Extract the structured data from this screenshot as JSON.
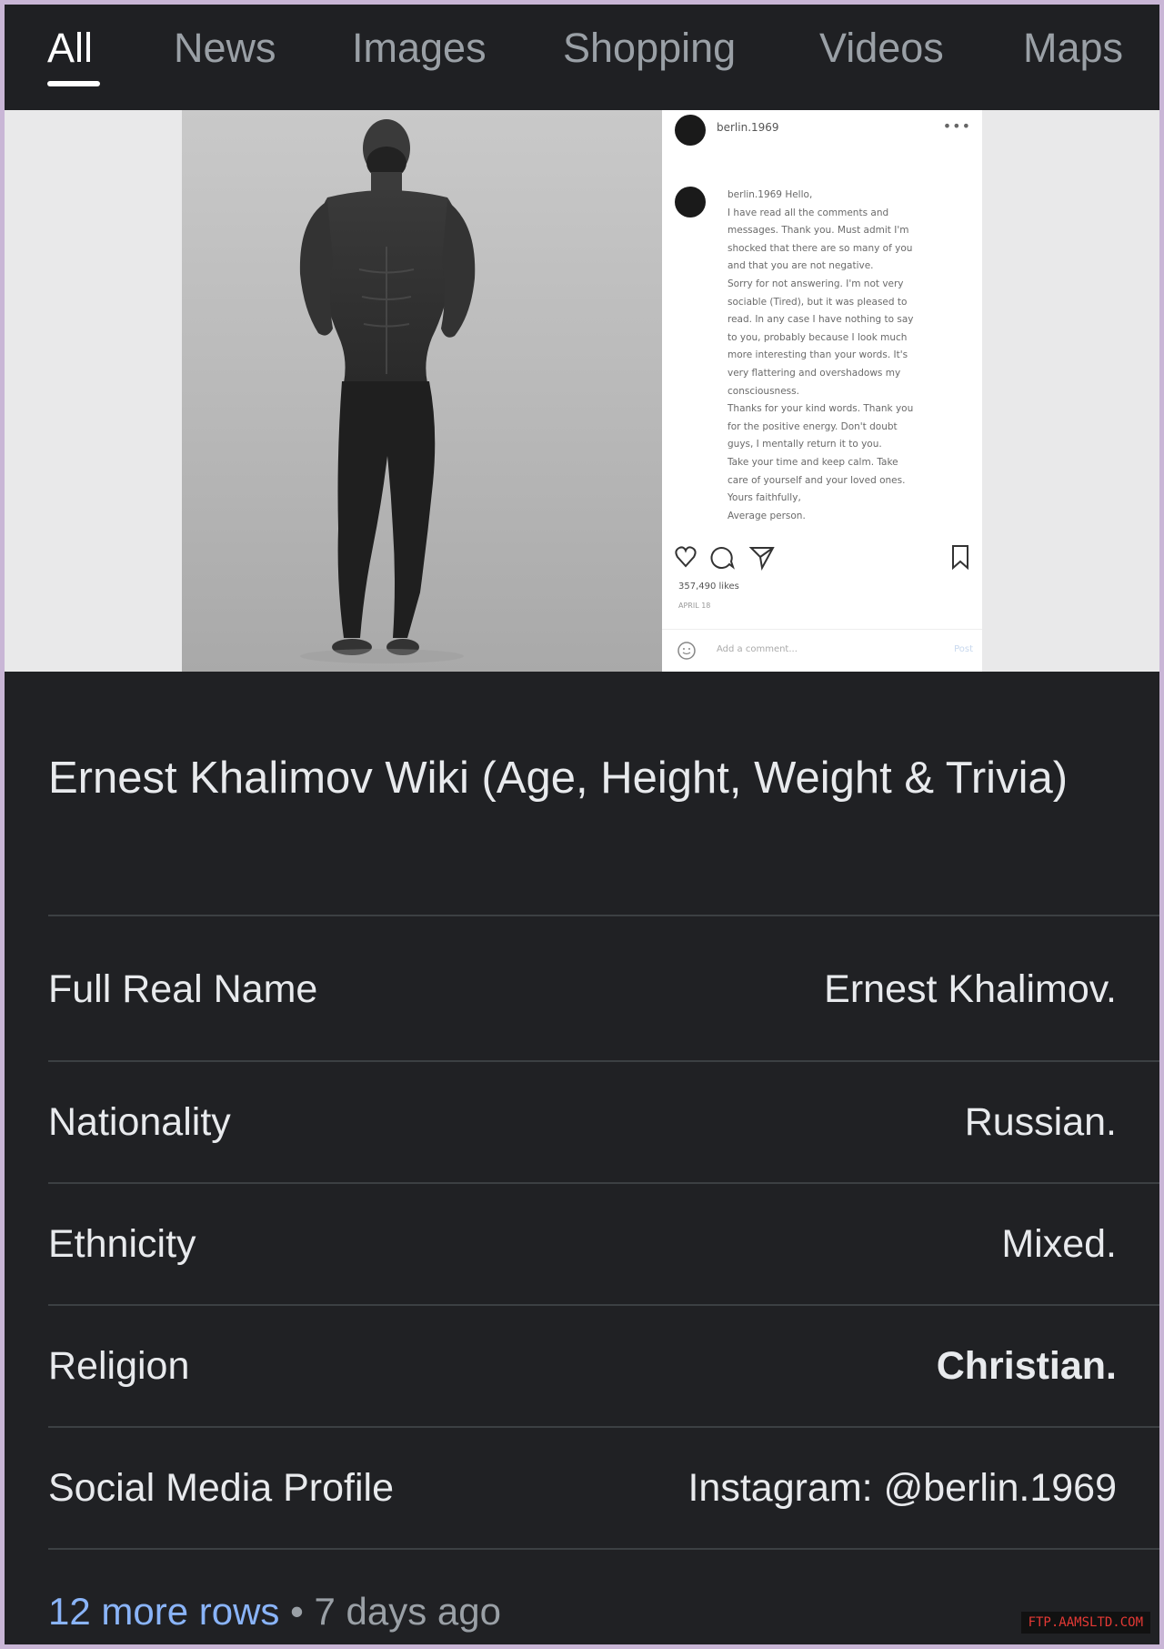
{
  "tabs": [
    {
      "label": "All",
      "active": true
    },
    {
      "label": "News"
    },
    {
      "label": "Images"
    },
    {
      "label": "Shopping"
    },
    {
      "label": "Videos"
    },
    {
      "label": "Maps"
    }
  ],
  "media": {
    "instagram": {
      "username": "berlin.1969",
      "caption_lines": [
        "berlin.1969 Hello,",
        "I have read all the comments and",
        "messages. Thank you. Must admit I'm",
        "shocked that there are so many of you",
        "and that you are not negative.",
        "Sorry for not answering. I'm not very",
        "sociable (Tired), but it was pleased to",
        "read. In any case I have nothing to say",
        "to you, probably because I look much",
        "more interesting than your words. It's",
        "very flattering and overshadows my",
        "consciousness.",
        "Thanks for your kind words. Thank you",
        "for the positive energy. Don't doubt",
        "guys, I mentally return it to you.",
        "Take your time and keep calm. Take",
        "care of yourself and your loved ones.",
        "Yours faithfully,",
        "Average person."
      ],
      "likes": "357,490 likes",
      "time": "APRIL 18",
      "comment_placeholder": "Add a comment...",
      "post_label": "Post"
    }
  },
  "result": {
    "title": "Ernest Khalimov Wiki (Age, Height, Weight & Trivia)",
    "rows": [
      {
        "label": "Full Real Name",
        "value": "Ernest Khalimov.",
        "bold": false
      },
      {
        "label": "Nationality",
        "value": "Russian.",
        "bold": false
      },
      {
        "label": "Ethnicity",
        "value": "Mixed.",
        "bold": false
      },
      {
        "label": "Religion",
        "value": "Christian.",
        "bold": true
      },
      {
        "label": "Social Media Profile",
        "value": "Instagram: @berlin.1969",
        "bold": false
      }
    ],
    "more_rows": "12 more rows",
    "separator": "•",
    "ago": "7 days ago"
  },
  "watermark": "FTP.AAMSLTD.COM",
  "colors": {
    "background": "#202124",
    "text": "#e8eaed",
    "muted": "#9aa0a6",
    "link": "#8ab4f8",
    "divider": "#3c4043",
    "frame": "#c9b6d6"
  }
}
